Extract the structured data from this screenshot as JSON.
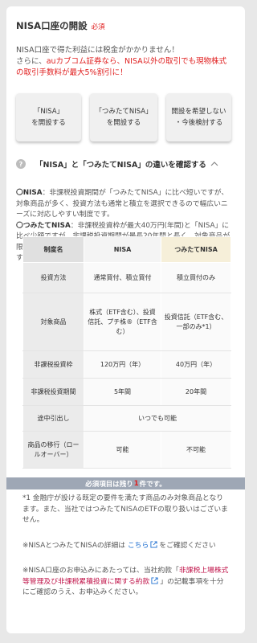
{
  "header": {
    "title": "NISA口座の開設",
    "required": "必須"
  },
  "intro": {
    "line1": "NISA口座で得た利益には税金がかかりません！",
    "line2_prefix": "さらに、",
    "line2_red": "auカブコム証券なら、NISA以外の取引でも現物株式の取引手数料が最大5%割引に！"
  },
  "choices": [
    {
      "label": "「NISA」\nを開設する"
    },
    {
      "label": "「つみたてNISA」\nを開設する"
    },
    {
      "label": "開設を希望しない\n・今後検討する"
    }
  ],
  "toggle": {
    "question_icon": "?",
    "label": "「NISA」と「つみたてNISA」の違いを確認する",
    "chevron": "chevron-up-icon"
  },
  "description": {
    "nisa_head": "〇NISA",
    "nisa_text": "：非課税投資期間が「つみたてNISA」に比べ短いですが、対象商品が多く、投資方法も通常と積立を選択できるので幅広いニーズに対応しやすい制度です。",
    "tsumitate_head": "〇つみたてNISA",
    "tsumitate_text": "：非課税投資枠が最大40万円(年間)と「NISA」に比べ少額ですが、非課税投資期間が最長20年間と長く、対象商品が限られているため、初心者の方には選びやすいとされている制度です。"
  },
  "table": {
    "headers": [
      "制度名",
      "NISA",
      "つみたてNISA"
    ],
    "rows": [
      {
        "label": "投資方法",
        "nisa": "通常買付、積立買付",
        "tsumitate": "積立買付のみ"
      },
      {
        "label": "対象商品",
        "nisa": "株式（ETF含む）、投資信託、プチ株®（ETF含む）",
        "tsumitate": "投資信託（ETF含む、一部のみ*1）"
      },
      {
        "label": "非課税投資枠",
        "nisa": "120万円（年）",
        "tsumitate": "40万円（年）"
      },
      {
        "label": "非課税投資期間",
        "nisa": "5年間",
        "tsumitate": "20年間"
      },
      {
        "label": "途中引出し",
        "both": "いつでも可能"
      },
      {
        "label": "商品の移行（ロールオーバー）",
        "nisa": "可能",
        "tsumitate": "不可能"
      }
    ]
  },
  "banner": {
    "prefix": "必須項目は残り",
    "count": "1",
    "suffix": "件です。"
  },
  "notes": {
    "n1": "*1 金融庁が設ける既定の要件を満たす商品のみ対象商品となります。また、当社ではつみたてNISAのETFの取り扱いはございません。",
    "n2_prefix": "※NISAとつみたてNISAの詳細は",
    "n2_link": "こちら",
    "n2_suffix": "をご確認ください",
    "n3_prefix": "※NISA口座のお申込みにあたっては、当社約款「",
    "n3_link": "非課税上場株式等管理及び非課税累積投資に関する約款",
    "n3_suffix": "」の記載事項を十分にご確認のうえ、お申込みください。"
  },
  "colors": {
    "accent_red": "#e02020",
    "link_blue": "#1e6fd0",
    "link_red": "#c0144a",
    "tsumitate_header": "#f6efd9"
  }
}
